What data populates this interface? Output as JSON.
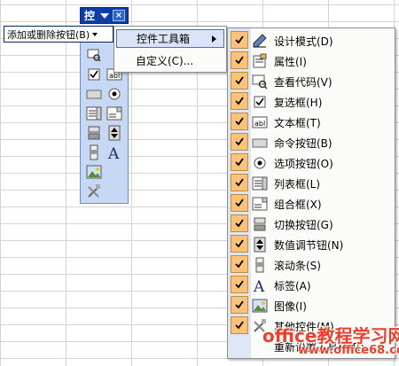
{
  "toolbar": {
    "title": "控",
    "close_label": "×",
    "add_remove_label": "添加或删除按钮(B)"
  },
  "menu1": {
    "items": [
      {
        "label": "控件工具箱",
        "has_submenu": true,
        "highlighted": true
      },
      {
        "label": "自定义(C)...",
        "has_submenu": false,
        "highlighted": false
      }
    ]
  },
  "menu2": {
    "items": [
      {
        "label": "设计模式(D)",
        "checked": true,
        "icon": "design-mode-icon"
      },
      {
        "label": "属性(I)",
        "checked": true,
        "icon": "properties-icon"
      },
      {
        "label": "查看代码(V)",
        "checked": true,
        "icon": "view-code-icon"
      },
      {
        "label": "复选框(H)",
        "checked": true,
        "icon": "checkbox-icon"
      },
      {
        "label": "文本框(T)",
        "checked": true,
        "icon": "textbox-icon"
      },
      {
        "label": "命令按钮(B)",
        "checked": true,
        "icon": "command-button-icon"
      },
      {
        "label": "选项按钮(O)",
        "checked": true,
        "icon": "option-button-icon"
      },
      {
        "label": "列表框(L)",
        "checked": true,
        "icon": "listbox-icon"
      },
      {
        "label": "组合框(X)",
        "checked": true,
        "icon": "combobox-icon"
      },
      {
        "label": "切换按钮(G)",
        "checked": true,
        "icon": "toggle-button-icon"
      },
      {
        "label": "数值调节钮(N)",
        "checked": true,
        "icon": "spin-button-icon"
      },
      {
        "label": "滚动条(S)",
        "checked": true,
        "icon": "scrollbar-icon"
      },
      {
        "label": "标签(A)",
        "checked": true,
        "icon": "label-icon"
      },
      {
        "label": "图像(I)",
        "checked": true,
        "icon": "image-icon"
      },
      {
        "label": "其他控件(M)",
        "checked": true,
        "icon": "more-controls-icon"
      },
      {
        "label": "重新设置工具栏(R)",
        "checked": false,
        "icon": ""
      }
    ]
  },
  "watermark": {
    "line1": "office教程学习网",
    "line2": "www.office68.com"
  },
  "colors": {
    "title_bar": "#0a3fa8",
    "toolbar_body": "#c6d8f4",
    "check_bg": "#fbc27b",
    "menu_gutter": "#dde6f5",
    "watermark": "#e8412d"
  }
}
